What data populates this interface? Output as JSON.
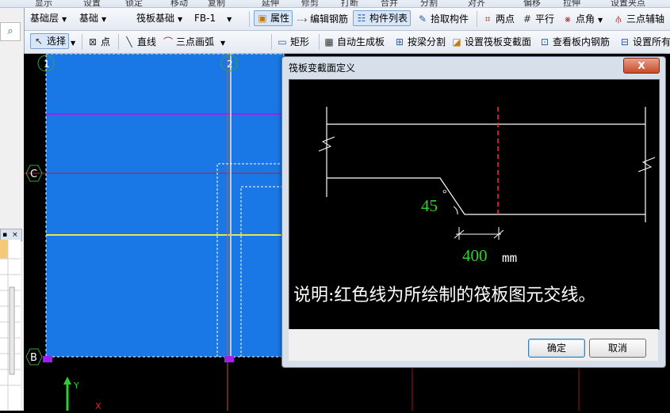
{
  "top_strip": [
    "显示",
    "设置",
    "锁定",
    "移动",
    "复制",
    "延伸",
    "修剪",
    "打断",
    "合并",
    "分割",
    "对齐",
    "偏移",
    "拉伸",
    "设置夹点"
  ],
  "toolbar1": {
    "layer": "基础层",
    "category": "基础",
    "element_type": "筏板基础",
    "element_name": "FB-1",
    "properties": "属性",
    "edit_rebar": "编辑钢筋",
    "element_list": "构件列表",
    "pick_element": "拾取构件",
    "two_points": "两点",
    "parallel": "平行",
    "point_angle": "点角",
    "three_point_axis": "三点辅轴"
  },
  "toolbar2": {
    "select": "选择",
    "point": "点",
    "line": "直线",
    "arc": "三点画弧",
    "rect": "矩形",
    "auto_gen": "自动生成板",
    "split_by_beam": "按梁分割",
    "set_section": "设置筏板变截面",
    "view_rebar": "查看板内钢筋",
    "set_all": "设置所有"
  },
  "canvas": {
    "axis_labels": [
      "1",
      "2",
      "C",
      "B"
    ],
    "y_axis": "Y",
    "x_axis": "X"
  },
  "dialog": {
    "title": "筏板变截面定义",
    "close": "X",
    "angle_value": "45",
    "degree_symbol": "°",
    "width_value": "400",
    "unit": "mm",
    "note": "说明:红色线为所绘制的筏板图元交线。",
    "ok": "确定",
    "cancel": "取消"
  },
  "colors": {
    "slab_fill": "#1a78e6",
    "section_line": "#ff2a2a",
    "value_text": "#2bd12b",
    "axis_purple": "#a020f0",
    "axis_yellow": "#e8e84a"
  }
}
